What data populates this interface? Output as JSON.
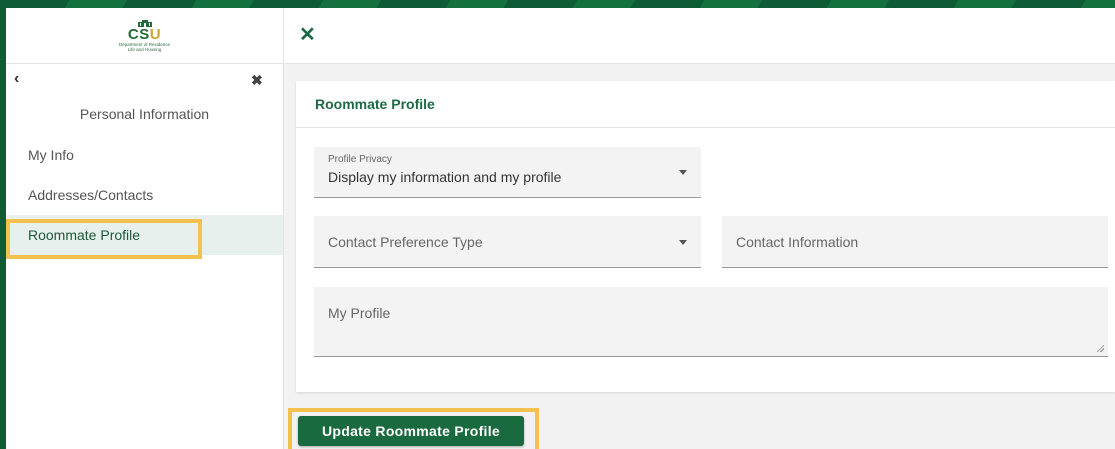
{
  "logo": {
    "text_main": "CS",
    "text_accent": "U",
    "subtitle_line1": "Department of Residence",
    "subtitle_line2": "Life and Housing"
  },
  "sidebar": {
    "back_icon": "chevron-left-icon",
    "close_icon": "close-icon",
    "title": "Personal Information",
    "items": [
      {
        "label": "My Info",
        "active": false
      },
      {
        "label": "Addresses/Contacts",
        "active": false
      },
      {
        "label": "Roommate Profile",
        "active": true
      }
    ]
  },
  "topbar": {
    "close_icon": "close-icon"
  },
  "card": {
    "title": "Roommate Profile",
    "profile_privacy": {
      "label": "Profile Privacy",
      "value": "Display my information and my profile"
    },
    "contact_preference": {
      "placeholder": "Contact Preference Type"
    },
    "contact_information": {
      "placeholder": "Contact Information"
    },
    "my_profile": {
      "placeholder": "My Profile"
    }
  },
  "actions": {
    "update_label": "Update Roommate Profile"
  },
  "colors": {
    "brand_green": "#1a6a3f",
    "highlight": "#f2c14e",
    "background_green": "#0d5c36"
  }
}
